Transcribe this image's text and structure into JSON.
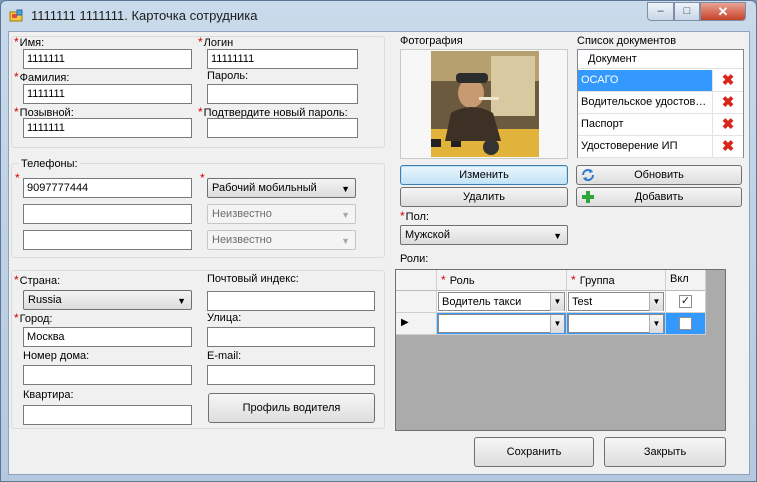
{
  "window": {
    "title": "1111111 1111111. Карточка сотрудника",
    "min": "–",
    "max": "□",
    "close": "✕"
  },
  "personal": {
    "first_name_label": "Имя:",
    "first_name_value": "1111111",
    "last_name_label": "Фамилия:",
    "last_name_value": "1111111",
    "callsign_label": "Позывной:",
    "callsign_value": "1111111",
    "login_label": "Логин",
    "login_value": "11111111",
    "password_label": "Пароль:",
    "password_value": "",
    "confirm_label": "Подтвердите новый пароль:",
    "confirm_value": ""
  },
  "phones": {
    "label": "Телефоны:",
    "rows": [
      {
        "number": "9097777444",
        "type": "Рабочий мобильный"
      },
      {
        "number": "",
        "type": "Неизвестно"
      },
      {
        "number": "",
        "type": "Неизвестно"
      }
    ]
  },
  "address": {
    "country_label": "Страна:",
    "country_value": "Russia",
    "postal_label": "Почтовый индекс:",
    "postal_value": "",
    "city_label": "Город:",
    "city_value": "Москва",
    "street_label": "Улица:",
    "street_value": "",
    "house_label": "Номер дома:",
    "house_value": "",
    "email_label": "E-mail:",
    "email_value": "",
    "apartment_label": "Квартира:",
    "apartment_value": "",
    "driver_profile_button": "Профиль водителя"
  },
  "photo": {
    "label": "Фотография",
    "change_button": "Изменить",
    "delete_button": "Удалить"
  },
  "gender": {
    "label": "Пол:",
    "value": "Мужской"
  },
  "documents": {
    "label": "Список документов",
    "column": "Документ",
    "items": [
      {
        "name": "ОСАГО",
        "selected": true
      },
      {
        "name": "Водительское удостоверение",
        "selected": false
      },
      {
        "name": "Паспорт",
        "selected": false
      },
      {
        "name": "Удостоверение ИП",
        "selected": false
      }
    ],
    "refresh_button": "Обновить",
    "add_button": "Добавить"
  },
  "roles": {
    "label": "Роли:",
    "col_role": "Роль",
    "col_group": "Группа",
    "col_enabled": "Вкл",
    "rows": [
      {
        "role": "Водитель такси",
        "group": "Test",
        "enabled": true
      },
      {
        "role": "",
        "group": "",
        "enabled": false
      }
    ]
  },
  "footer": {
    "save_button": "Сохранить",
    "close_button": "Закрыть"
  },
  "colors": {
    "accent": "#3399ff",
    "required": "#d40000"
  }
}
